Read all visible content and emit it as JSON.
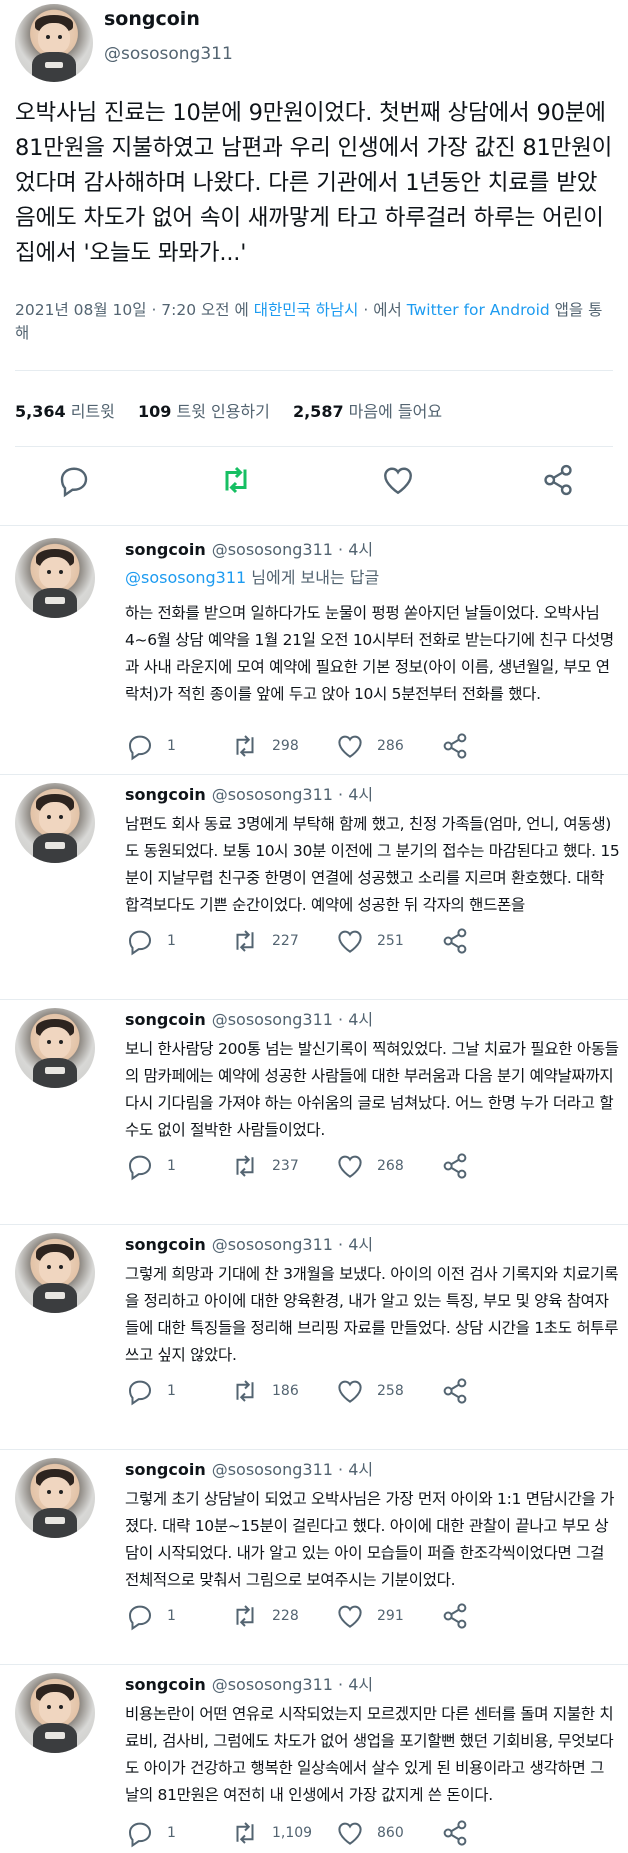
{
  "main": {
    "display_name": "songcoin",
    "handle": "@sososong311",
    "text": "오박사님 진료는 10분에 9만원이었다. 첫번째 상담에서 90분에 81만원을 지불하였고 남편과 우리 인생에서 가장 값진 81만원이었다며 감사해하며 나왔다. 다른 기관에서 1년동안 치료를 받았음에도 차도가 없어 속이 새까맣게 타고 하루걸러 하루는 어린이집에서 '오늘도 뫄뫄가...'",
    "meta_date": "2021년 08월 10일 · 7:20 오전 에",
    "meta_location": "대한민국 하남시",
    "meta_mid": " · 에서",
    "meta_source": "Twitter for Android",
    "meta_end": "앱을 통해",
    "stats": {
      "retweets_count": "5,364",
      "retweets_label": "리트윗",
      "quotes_count": "109",
      "quotes_label": "트윗 인용하기",
      "likes_count": "2,587",
      "likes_label": "마음에 들어요"
    },
    "icons": [
      "reply-icon",
      "retweet-icon",
      "like-icon",
      "share-icon"
    ],
    "retweet_color": "#17bf63"
  },
  "replies": [
    {
      "name": "songcoin",
      "handle": "@sososong311",
      "time": "· 4시",
      "reply_to_mention": "@sososong311",
      "reply_to_suffix": " 님에게 보내는 답글",
      "text": "하는 전화를 받으며 일하다가도 눈물이 펑펑 쏟아지던 날들이었다. 오박사님 4~6월 상담 예약을 1월 21일 오전 10시부터 전화로 받는다기에 친구 다섯명과 사내 라운지에 모여 예약에 필요한 기본 정보(아이 이름, 생년월일, 부모 연락처)가 적힌 종이를 앞에 두고 앉아 10시 5분전부터 전화를 했다.",
      "replies": "1",
      "retweets": "298",
      "likes": "286"
    },
    {
      "name": "songcoin",
      "handle": "@sososong311",
      "time": "· 4시",
      "text": "남편도 회사 동료 3명에게 부탁해 함께 했고, 친정 가족들(엄마, 언니, 여동생)도 동원되었다. 보통 10시 30분 이전에 그 분기의 접수는 마감된다고 했다. 15분이 지날무렵 친구중 한명이 연결에 성공했고 소리를 지르며 환호했다. 대학 합격보다도 기쁜 순간이었다. 예약에 성공한 뒤 각자의 핸드폰을",
      "replies": "1",
      "retweets": "227",
      "likes": "251"
    },
    {
      "name": "songcoin",
      "handle": "@sososong311",
      "time": "· 4시",
      "text": "보니 한사람당 200통 넘는 발신기록이 찍혀있었다. 그날 치료가 필요한 아동들의 맘카페에는 예약에 성공한 사람들에 대한 부러움과 다음 분기 예약날짜까지 다시 기다림을 가져야 하는 아쉬움의 글로 넘쳐났다. 어느 한명 누가 더라고 할수도 없이 절박한 사람들이었다.",
      "replies": "1",
      "retweets": "237",
      "likes": "268"
    },
    {
      "name": "songcoin",
      "handle": "@sososong311",
      "time": "· 4시",
      "text": "그렇게 희망과 기대에 찬 3개월을 보냈다. 아이의 이전 검사 기록지와 치료기록을 정리하고 아이에 대한 양육환경, 내가 알고 있는 특징, 부모 및 양육 참여자들에 대한 특징들을 정리해 브리핑 자료를 만들었다. 상담 시간을 1초도 허투루 쓰고 싶지 않았다.",
      "replies": "1",
      "retweets": "186",
      "likes": "258"
    },
    {
      "name": "songcoin",
      "handle": "@sososong311",
      "time": "· 4시",
      "text": "그렇게 초기 상담날이 되었고 오박사님은 가장 먼저 아이와 1:1 면담시간을 가졌다. 대략 10분~15분이 걸린다고 했다. 아이에 대한 관찰이 끝나고 부모 상담이 시작되었다. 내가 알고 있는 아이 모습들이 퍼즐 한조각씩이었다면 그걸 전체적으로 맞춰서 그림으로 보여주시는 기분이었다.",
      "replies": "1",
      "retweets": "228",
      "likes": "291"
    },
    {
      "name": "songcoin",
      "handle": "@sososong311",
      "time": "· 4시",
      "text": "비용논란이 어떤 연유로 시작되었는지 모르겠지만 다른 센터를 돌며 지불한 치료비, 검사비, 그럼에도 차도가 없어 생업을 포기할뻔 했던 기회비용, 무엇보다도 아이가 건강하고 행복한 일상속에서 살수 있게 된 비용이라고 생각하면 그 날의 81만원은 여전히 내 인생에서 가장 값지게 쓴 돈이다.",
      "replies": "1",
      "retweets": "1,109",
      "likes": "860"
    }
  ]
}
